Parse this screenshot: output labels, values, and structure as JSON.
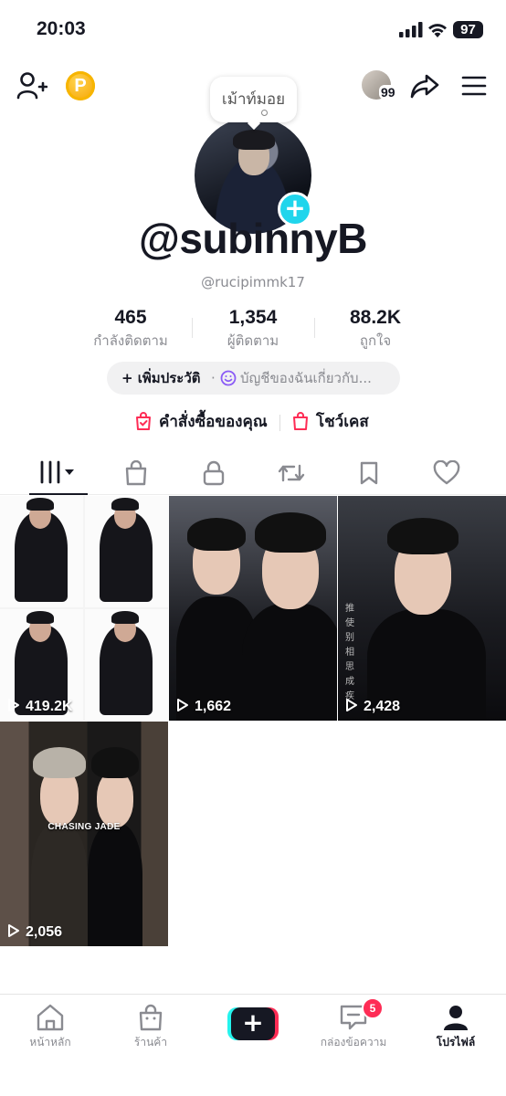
{
  "status_bar": {
    "time": "20:03",
    "battery": "97"
  },
  "header": {
    "coin_letter": "P",
    "visitor_count": "99",
    "note_bubble": "เม้าท์มอย"
  },
  "profile": {
    "display_name": "@subinnyB",
    "username": "@rucipimmk17",
    "stats": [
      {
        "value": "465",
        "label": "กำลังติดตาม"
      },
      {
        "value": "1,354",
        "label": "ผู้ติดตาม"
      },
      {
        "value": "88.2K",
        "label": "ถูกใจ"
      }
    ],
    "bio_add": "+ เพิ่มประวัติ",
    "bio_separator": "·",
    "bio_prompt": "บัญชีของฉันเกี่ยวกับ...",
    "links": {
      "orders": "คำสั่งซื้อของคุณ",
      "showcase": "โชว์เคส"
    }
  },
  "tabs": [
    "videos-grid",
    "shop-bag",
    "private-lock",
    "reposts",
    "favorites-bookmark",
    "liked-heart"
  ],
  "videos": [
    {
      "views": "419.2K"
    },
    {
      "views": "1,662"
    },
    {
      "views": "2,428",
      "overlay_text": "推使别相思成疾"
    },
    {
      "views": "2,056",
      "overlay_text": "CHASING JADE"
    }
  ],
  "bottom_nav": {
    "home": "หน้าหลัก",
    "shop": "ร้านค้า",
    "create": "+",
    "inbox": "กล่องข้อความ",
    "inbox_badge": "5",
    "profile": "โปรไฟล์"
  },
  "colors": {
    "accent_pink": "#fe2c55",
    "accent_cyan": "#25f4ee",
    "text": "#161823",
    "muted": "#8a8b91",
    "coin": "#f5a100"
  }
}
